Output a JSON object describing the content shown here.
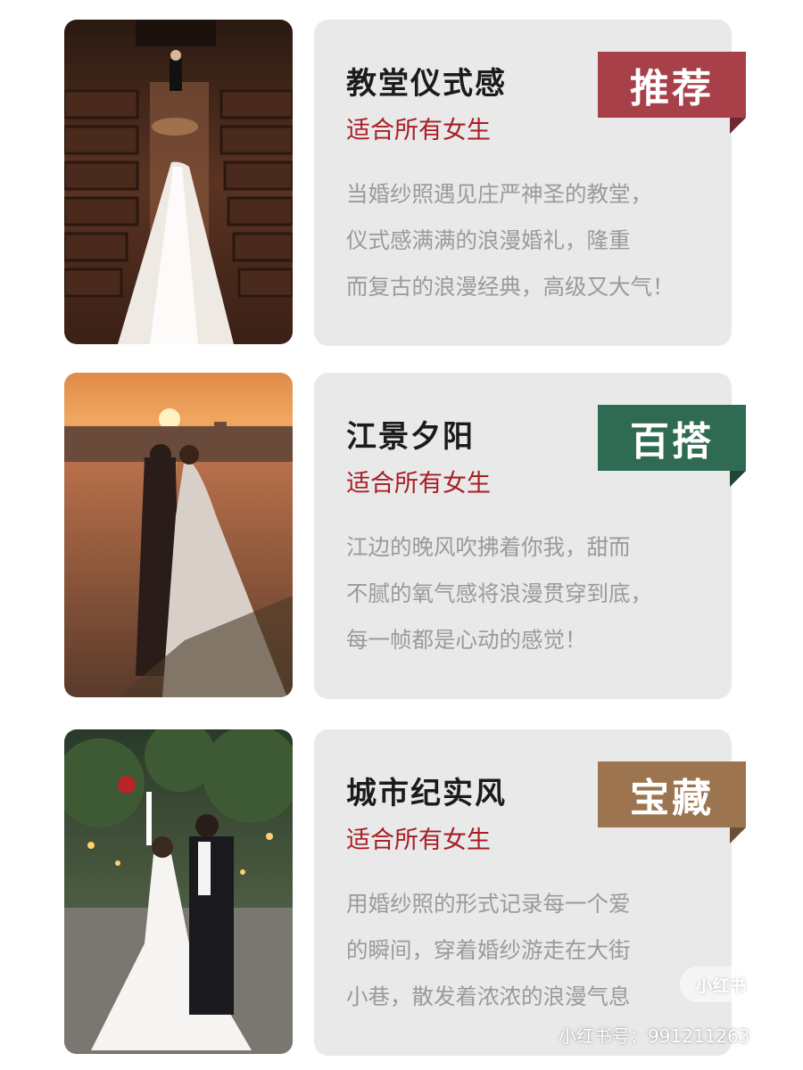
{
  "cards": [
    {
      "title": "教堂仪式感",
      "subtitle": "适合所有女生",
      "tag": "推荐",
      "tag_color": "#a8404a",
      "tag_fold_color": "#6e2a30",
      "description_lines": [
        "当婚纱照遇见庄严神圣的教堂，",
        "仪式感满满的浪漫婚礼，隆重",
        "而复古的浪漫经典，高级又大气！"
      ]
    },
    {
      "title": "江景夕阳",
      "subtitle": "适合所有女生",
      "tag": "百搭",
      "tag_color": "#2f6b53",
      "tag_fold_color": "#1f4636",
      "description_lines": [
        "江边的晚风吹拂着你我，甜而",
        "不腻的氧气感将浪漫贯穿到底，",
        "每一帧都是心动的感觉！"
      ]
    },
    {
      "title": "城市纪实风",
      "subtitle": "适合所有女生",
      "tag": "宝藏",
      "tag_color": "#9c7550",
      "tag_fold_color": "#6b4f35",
      "description_lines": [
        "用婚纱照的形式记录每一个爱",
        "的瞬间，穿着婚纱游走在大街",
        "小巷，散发着浓浓的浪漫气息"
      ]
    }
  ],
  "watermark": {
    "logo": "小红书",
    "id_text": "小红书号：991211263"
  }
}
